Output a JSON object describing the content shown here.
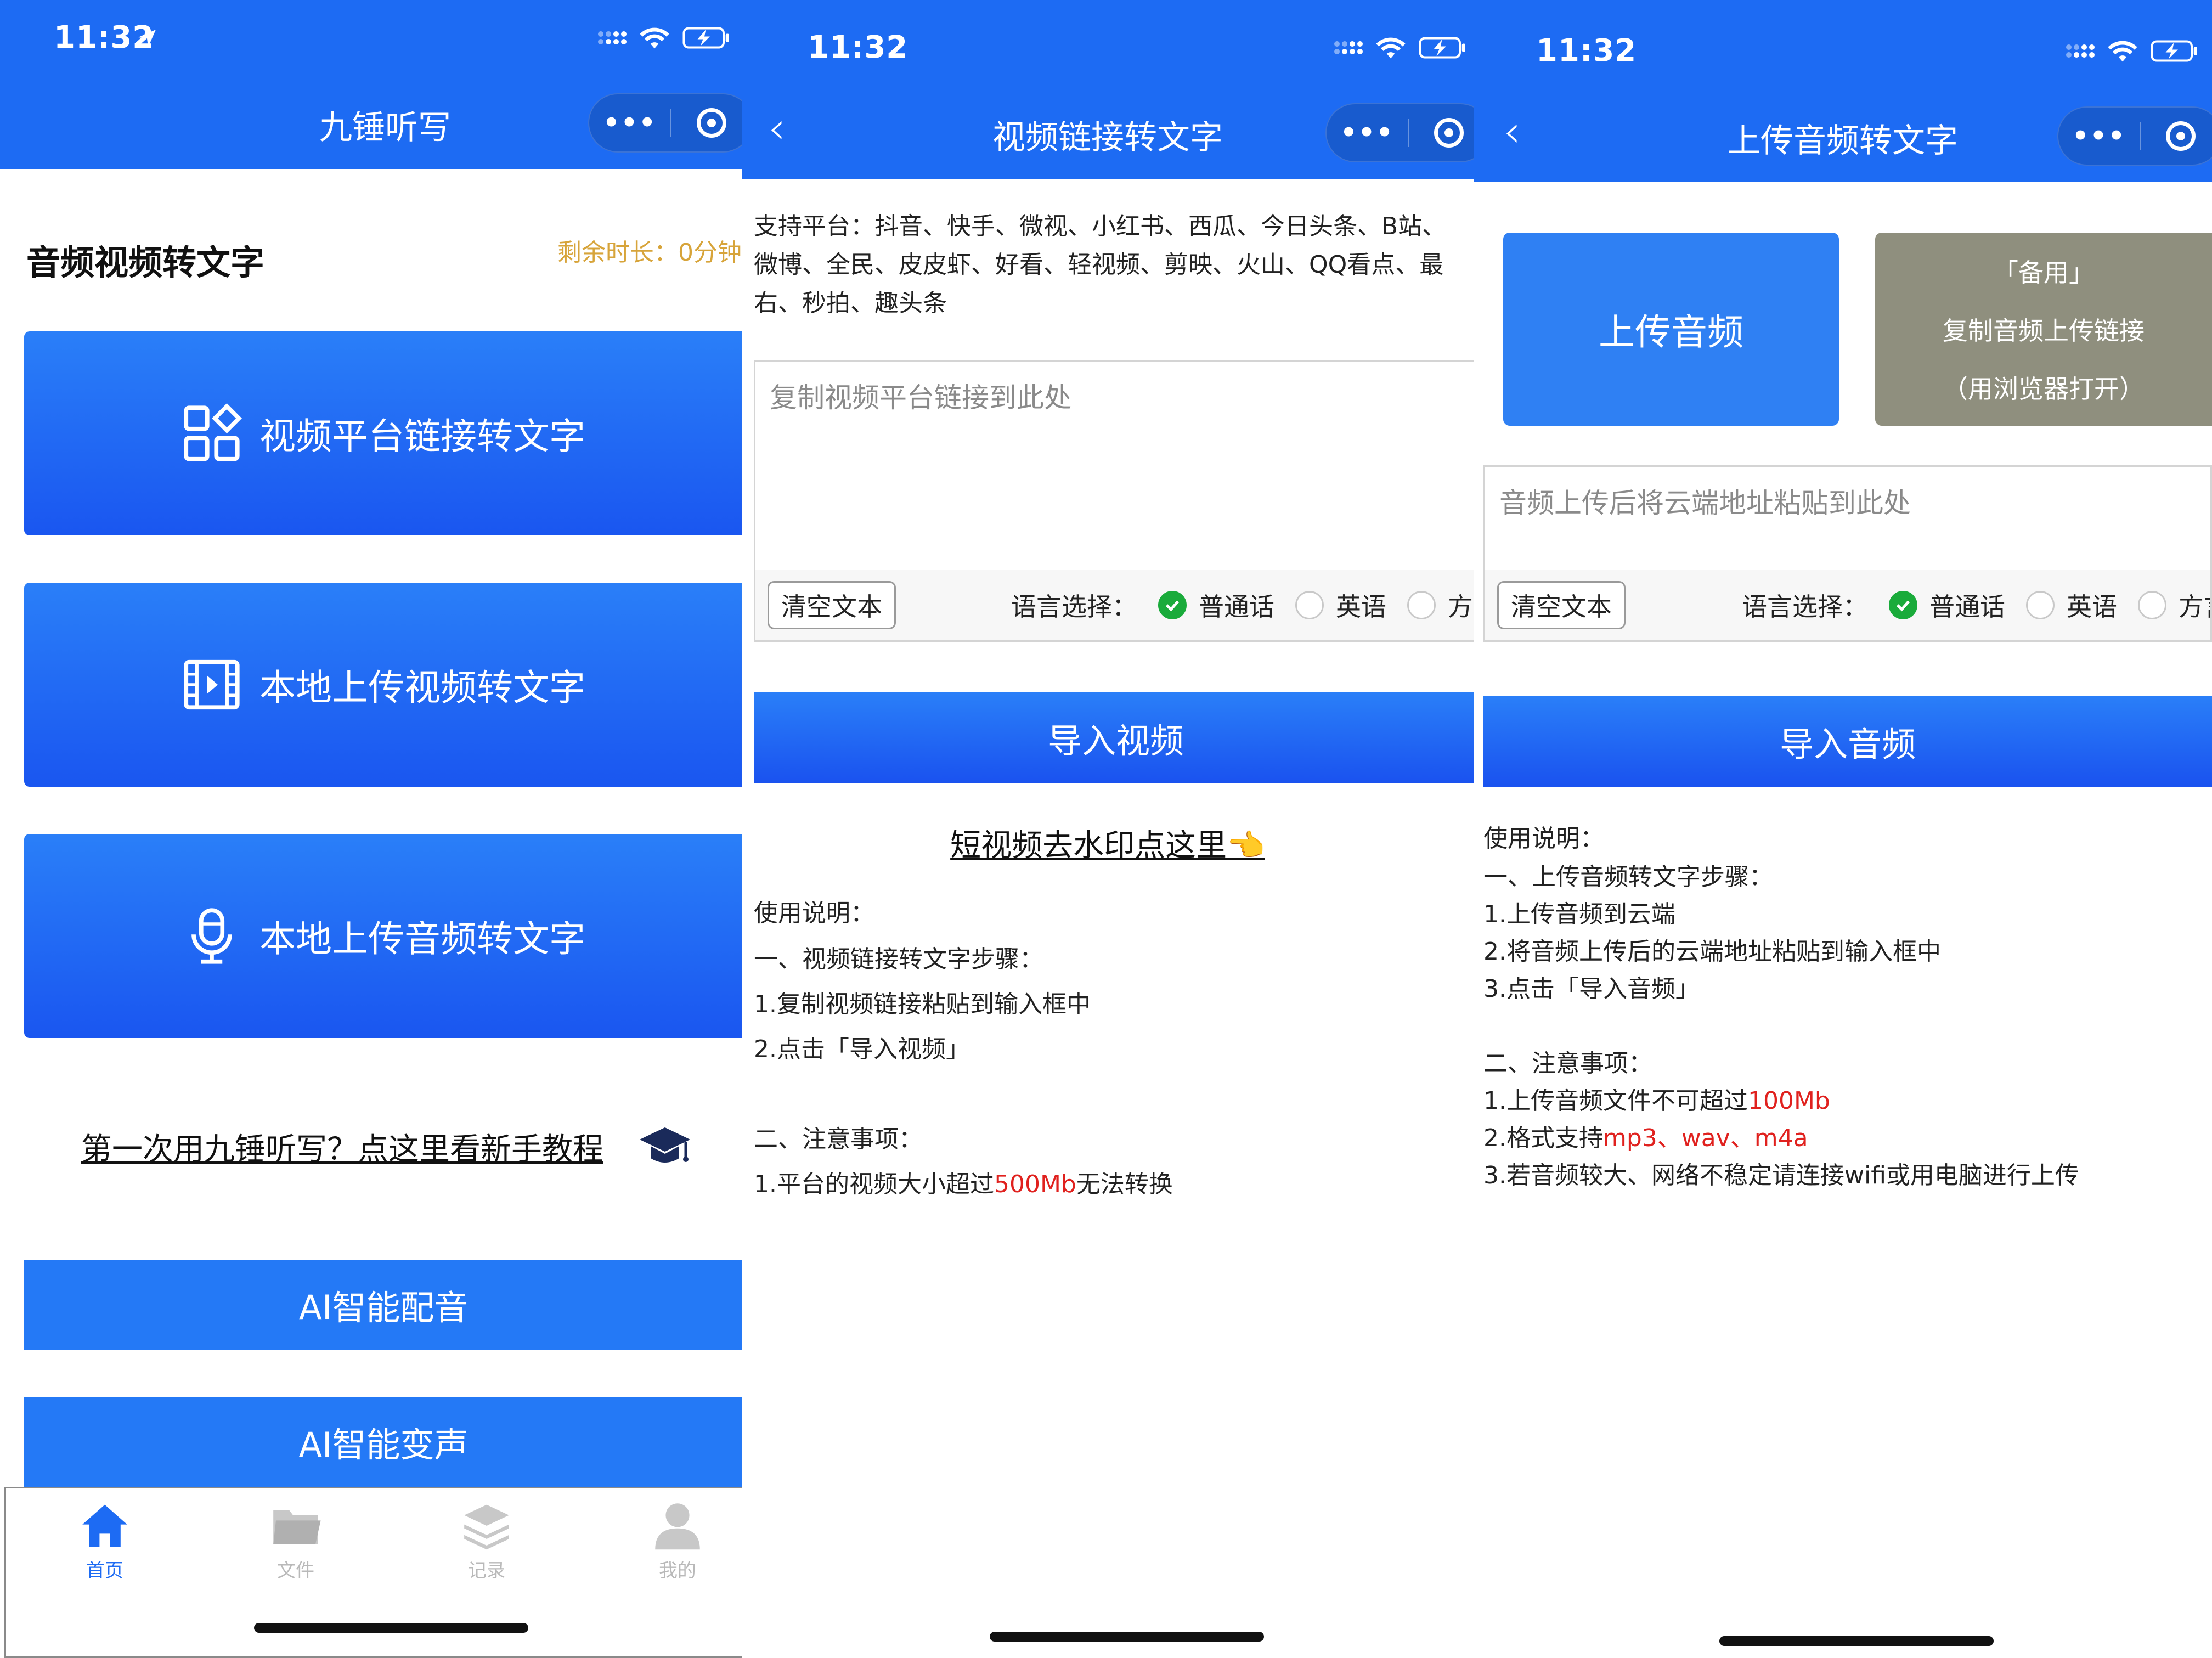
{
  "screen1": {
    "status": {
      "time": "11:32"
    },
    "nav_title": "九锤听写",
    "heading": "音频视频转文字",
    "remaining": "剩余时长：0分钟",
    "buttons": [
      {
        "label": "视频平台链接转文字",
        "icon": "apps-grid-icon"
      },
      {
        "label": "本地上传视频转文字",
        "icon": "film-icon"
      },
      {
        "label": "本地上传音频转文字",
        "icon": "microphone-icon"
      }
    ],
    "tutorial_link": "第一次用九锤听写？点这里看新手教程",
    "ai_buttons": [
      {
        "label": "AI智能配音"
      },
      {
        "label": "AI智能变声"
      }
    ],
    "tabbar": [
      {
        "label": "首页",
        "icon": "home-icon",
        "active": true
      },
      {
        "label": "文件",
        "icon": "folder-icon",
        "active": false
      },
      {
        "label": "记录",
        "icon": "layers-icon",
        "active": false
      },
      {
        "label": "我的",
        "icon": "person-icon",
        "active": false
      }
    ]
  },
  "screen2": {
    "status": {
      "time": "11:32"
    },
    "nav_title": "视频链接转文字",
    "platforms_lines": [
      "支持平台：抖音、快手、微视、小红书、西瓜、今日头条、B站、",
      "微博、全民、皮皮虾、好看、轻视频、剪映、火山、QQ看点、最",
      "右、秒拍、趣头条"
    ],
    "input_placeholder": "复制视频平台链接到此处",
    "clear_label": "清空文本",
    "language_label": "语言选择：",
    "languages": [
      "普通话",
      "英语",
      "方言"
    ],
    "import_label": "导入视频",
    "watermark_link": "短视频去水印点这里👈",
    "instructions": {
      "title": "使用说明：",
      "section1": "一、视频链接转文字步骤：",
      "step1": "1.复制视频链接粘贴到输入框中",
      "step2": "2.点击「导入视频」",
      "section2": "二、注意事项：",
      "note1_pre": "1.平台的视频大小超过",
      "note1_red": "500Mb",
      "note1_post": "无法转换"
    }
  },
  "screen3": {
    "status": {
      "time": "11:32"
    },
    "nav_title": "上传音频转文字",
    "upload_label": "上传音频",
    "backup": {
      "line1": "「备用」",
      "line2": "复制音频上传链接",
      "line3": "（用浏览器打开）"
    },
    "input_placeholder": "音频上传后将云端地址粘贴到此处",
    "clear_label": "清空文本",
    "language_label": "语言选择：",
    "languages": [
      "普通话",
      "英语",
      "方言"
    ],
    "import_label": "导入音频",
    "instructions": {
      "title": "使用说明：",
      "section1": "一、上传音频转文字步骤：",
      "step1": "1.上传音频到云端",
      "step2": "2.将音频上传后的云端地址粘贴到输入框中",
      "step3": "3.点击「导入音频」",
      "section2": "二、注意事项：",
      "note1_pre": "1.上传音频文件不可超过",
      "note1_red": "100Mb",
      "note2_pre": "2.格式支持",
      "note2_red": "mp3、wav、m4a",
      "note3": "3.若音频较大、网络不稳定请连接wifi或用电脑进行上传"
    }
  },
  "colors": {
    "brand_blue": "#1d6bf3",
    "accent_red": "#e0211e",
    "remaining_gold": "#d7a43a",
    "check_green": "#1aab3b",
    "backup_gray": "#8f8f7e"
  }
}
